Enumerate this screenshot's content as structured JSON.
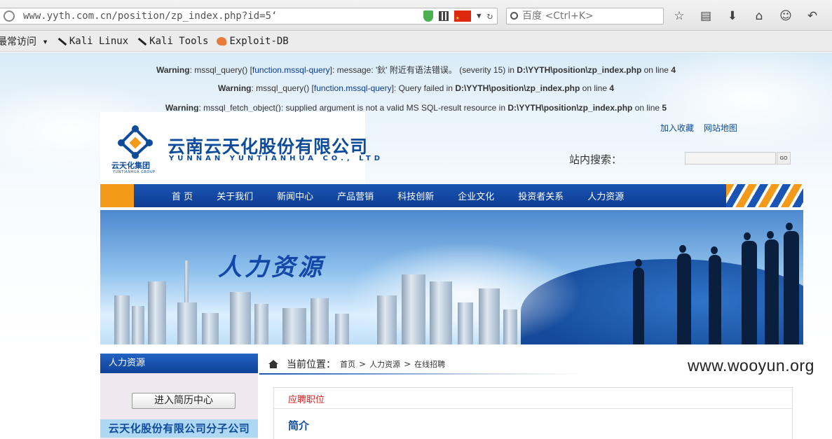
{
  "browser": {
    "url": "www.yyth.com.cn/position/zp_index.php?id=5‘",
    "search_placeholder": "百度 <Ctrl+K>",
    "bookmarks": [
      {
        "label": "最常访问 ▾",
        "icon": "none"
      },
      {
        "label": "Kali Linux",
        "icon": "kali-dragon-icon"
      },
      {
        "label": "Kali Tools",
        "icon": "kali-dragon-icon"
      },
      {
        "label": "Exploit-DB",
        "icon": "exploit-db-icon"
      }
    ]
  },
  "warnings": [
    {
      "level": "Warning",
      "pre": ": mssql_query() [",
      "fn": "function.mssql-query",
      "post": "]: message: '鈥' 附近有语法错误。 (severity 15) in ",
      "file": "D:\\YYTH\\position\\zp_index.php",
      "online": " on line ",
      "line": "4"
    },
    {
      "level": "Warning",
      "pre": ": mssql_query() [",
      "fn": "function.mssql-query",
      "post": "]: Query failed in ",
      "file": "D:\\YYTH\\position\\zp_index.php",
      "online": " on line ",
      "line": "4"
    },
    {
      "level": "Warning",
      "pre": ": mssql_fetch_object(): supplied argument is not a valid MS SQL-result resource in ",
      "fn": "",
      "post": "",
      "file": "D:\\YYTH\\position\\zp_index.php",
      "online": " on line ",
      "line": "5"
    }
  ],
  "header": {
    "company_cn": "云南云天化股份有限公司",
    "company_en": "YUNNAN YUNTIANHUA CO., LTD",
    "logo_text": "云天化集团",
    "logo_sub": "YUNTIANHUA GROUP",
    "top_links": [
      "加入收藏",
      "网站地图"
    ],
    "search_label": "站内搜索：",
    "search_go": "GO"
  },
  "nav": [
    "首 页",
    "关于我们",
    "新闻中心",
    "产品营销",
    "科技创新",
    "企业文化",
    "投资者关系",
    "人力资源"
  ],
  "banner": {
    "title": "人力资源"
  },
  "sidebar": {
    "heading": "人力资源",
    "resume_button": "进入简历中心",
    "subsidiary": "云天化股份有限公司分子公司"
  },
  "breadcrumb": {
    "label": "当前位置：",
    "items": [
      "首页",
      "人力资源",
      "在线招聘"
    ],
    "separator": ">"
  },
  "panel": {
    "title": "应聘职位",
    "subtitle": "简介"
  },
  "watermark": "www.wooyun.org",
  "colors": {
    "brand_blue": "#0e4c9b",
    "nav_orange": "#f39a1a",
    "error_red": "#c22"
  }
}
